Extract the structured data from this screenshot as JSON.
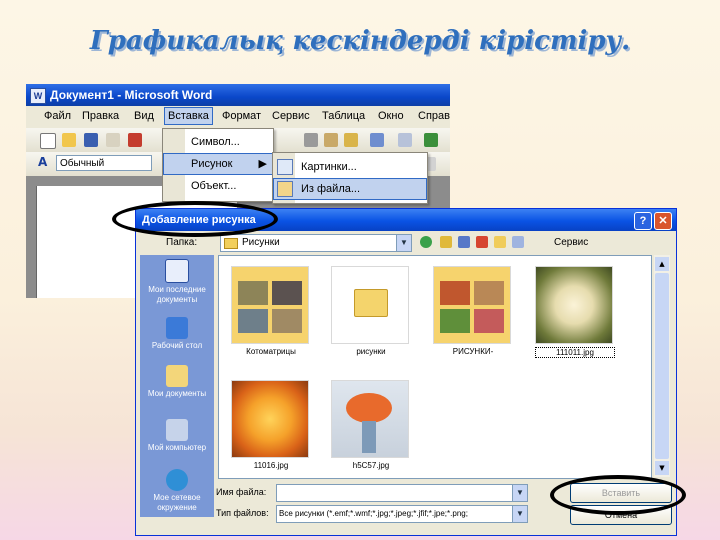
{
  "slide_title": "Графикалық кескіндерді кірістіру.",
  "word": {
    "title": "Документ1 - Microsoft Word",
    "icon_letter": "W",
    "menu": [
      "Файл",
      "Правка",
      "Вид",
      "Вставка",
      "Формат",
      "Сервис",
      "Таблица",
      "Окно",
      "Справк"
    ],
    "style_value": "Обычный"
  },
  "insert_menu": {
    "items": [
      "Символ...",
      "Рисунок",
      "Объект..."
    ]
  },
  "picture_submenu": {
    "items": [
      "Картинки...",
      "Из файла..."
    ]
  },
  "dialog": {
    "title": "Добавление рисунка",
    "look_in_label": "Папка:",
    "look_in_value": "Рисунки",
    "tools_label": "Сервис",
    "places": [
      "Мои последние документы",
      "Рабочий стол",
      "Мои документы",
      "Мой компьютер",
      "Мое сетевое окружение"
    ],
    "files": [
      "Котоматрицы",
      "рисунки",
      "РИСУНКИ-",
      "111011.jpg",
      "11016.jpg",
      "h5C57.jpg"
    ],
    "file_name_label": "Имя файла:",
    "file_name_value": "",
    "file_type_label": "Тип файлов:",
    "file_type_value": "Все рисунки (*.emf;*.wmf;*.jpg;*.jpeg;*.jfif;*.jpe;*.png;",
    "insert_button": "Вставить",
    "cancel_button": "Отмена"
  },
  "colors": {
    "title_blue": "#2f6fbd",
    "xp_blue": "#0a53e4",
    "highlight": "#c1d2ee"
  }
}
